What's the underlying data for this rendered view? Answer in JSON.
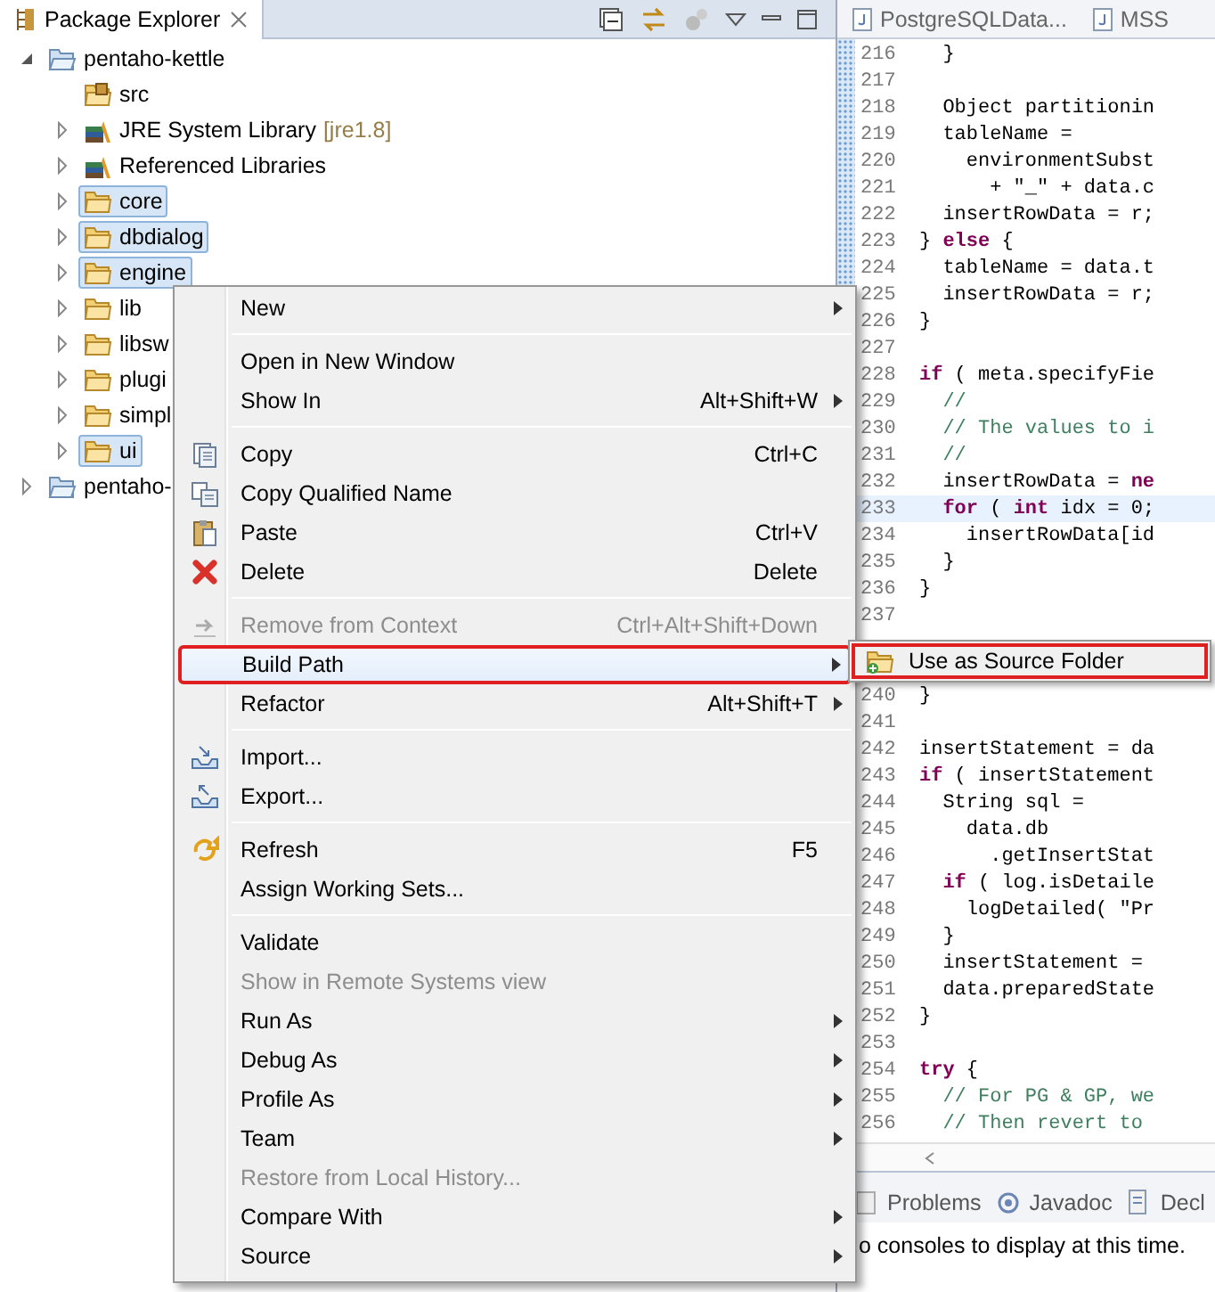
{
  "explorer": {
    "title": "Package Explorer",
    "tree": [
      {
        "label": "pentaho-kettle",
        "kind": "project",
        "expanded": true,
        "selected": false,
        "children": [
          {
            "label": "src",
            "kind": "source",
            "selected": false
          },
          {
            "label": "JRE System Library",
            "decoration": "[jre1.8]",
            "kind": "library",
            "expanded": false,
            "selected": false
          },
          {
            "label": "Referenced Libraries",
            "kind": "library",
            "expanded": false,
            "selected": false
          },
          {
            "label": "core",
            "kind": "folder",
            "expanded": false,
            "selected": true
          },
          {
            "label": "dbdialog",
            "kind": "folder",
            "expanded": false,
            "selected": true
          },
          {
            "label": "engine",
            "kind": "folder",
            "expanded": false,
            "selected": true
          },
          {
            "label": "lib",
            "kind": "folder",
            "expanded": false,
            "selected": false
          },
          {
            "label": "libsw",
            "kind": "folder",
            "expanded": false,
            "selected": false
          },
          {
            "label": "plugi",
            "kind": "folder",
            "expanded": false,
            "selected": false
          },
          {
            "label": "simpl",
            "kind": "folder",
            "expanded": false,
            "selected": false
          },
          {
            "label": "ui",
            "kind": "folder",
            "expanded": false,
            "selected": true
          }
        ]
      },
      {
        "label": "pentaho-",
        "kind": "project",
        "expanded": false,
        "selected": false
      }
    ]
  },
  "editor": {
    "tabs": [
      {
        "label": "PostgreSQLData...",
        "selected": false
      },
      {
        "label": "MSS",
        "selected": false
      }
    ],
    "lines": [
      {
        "number": "216",
        "text": "  }",
        "kind": "code",
        "current": false
      },
      {
        "number": "217",
        "current": false
      },
      {
        "number": "218",
        "text": "  Object partitionin",
        "kind": "code",
        "current": false
      },
      {
        "number": "219",
        "text": "  tableName =",
        "kind": "code",
        "current": false
      },
      {
        "number": "220",
        "text": "    environmentSubst",
        "kind": "code",
        "current": false
      },
      {
        "number": "221",
        "text": "      + \"_\" + data.c",
        "kind": "code",
        "current": false
      },
      {
        "number": "222",
        "text": "  insertRowData = r;",
        "kind": "code",
        "current": false
      },
      {
        "number": "223",
        "text": "} **else** {",
        "kind": "code",
        "current": false
      },
      {
        "number": "224",
        "text": "  tableName = data.t",
        "kind": "code",
        "current": false
      },
      {
        "number": "225",
        "text": "  insertRowData = r;",
        "kind": "code",
        "current": false
      },
      {
        "number": "226",
        "text": "}",
        "kind": "code",
        "current": false
      },
      {
        "number": "227",
        "current": false
      },
      {
        "number": "228",
        "text": "**if** ( meta.specifyFie",
        "kind": "code",
        "current": false
      },
      {
        "number": "229",
        "text": "  //",
        "kind": "comment",
        "current": false
      },
      {
        "number": "230",
        "text": "  // The values to i",
        "kind": "comment",
        "current": false
      },
      {
        "number": "231",
        "text": "  //",
        "kind": "comment",
        "current": false
      },
      {
        "number": "232",
        "text": "  insertRowData = **ne**",
        "kind": "code",
        "current": false
      },
      {
        "number": "233",
        "text": "  **for** ( **int** idx = 0;",
        "kind": "code",
        "current": true
      },
      {
        "number": "234",
        "text": "    insertRowData[id",
        "kind": "code",
        "current": false
      },
      {
        "number": "235",
        "text": "  }",
        "kind": "code",
        "current": false
      },
      {
        "number": "236",
        "text": "}",
        "kind": "code",
        "current": false
      },
      {
        "number": "237",
        "current": false
      },
      {
        "number": "240",
        "text": "}",
        "kind": "code",
        "current": false
      },
      {
        "number": "241",
        "current": false
      },
      {
        "number": "242",
        "text": "insertStatement = da",
        "kind": "code",
        "current": false
      },
      {
        "number": "243",
        "text": "**if** ( insertStatement",
        "kind": "code",
        "current": false
      },
      {
        "number": "244",
        "text": "  String sql =",
        "kind": "code",
        "current": false
      },
      {
        "number": "245",
        "text": "    data.db",
        "kind": "code",
        "current": false
      },
      {
        "number": "246",
        "text": "      .getInsertStat",
        "kind": "code",
        "current": false
      },
      {
        "number": "247",
        "text": "  **if** ( log.isDetaile",
        "kind": "code",
        "current": false
      },
      {
        "number": "248",
        "text": "    logDetailed( \"Pr",
        "kind": "code",
        "current": false
      },
      {
        "number": "249",
        "text": "  }",
        "kind": "code",
        "current": false
      },
      {
        "number": "250",
        "text": "  insertStatement =",
        "kind": "code",
        "current": false
      },
      {
        "number": "251",
        "text": "  data.preparedState",
        "kind": "code",
        "current": false
      },
      {
        "number": "252",
        "text": "}",
        "kind": "code",
        "current": false
      },
      {
        "number": "253",
        "current": false
      },
      {
        "number": "254",
        "text": "**try** {",
        "kind": "code",
        "current": false
      },
      {
        "number": "255",
        "text": "  // For PG & GP, we",
        "kind": "comment",
        "current": false
      },
      {
        "number": "256",
        "text": "  // Then revert to",
        "kind": "comment",
        "current": false
      }
    ]
  },
  "console": {
    "tabs": [
      {
        "label": "Problems",
        "kind": "problems"
      },
      {
        "label": "Javadoc",
        "kind": "javadoc"
      },
      {
        "label": "Decl",
        "kind": "declaration"
      }
    ],
    "message": "o consoles to display at this time."
  },
  "context_menu": {
    "items": [
      {
        "kind": "item",
        "label": "New",
        "submenu": true,
        "disabled": false,
        "selected": false,
        "outlined": false
      },
      {
        "kind": "separator"
      },
      {
        "kind": "item",
        "label": "Open in New Window",
        "submenu": false,
        "disabled": false,
        "selected": false,
        "outlined": false
      },
      {
        "kind": "item",
        "label": "Show In",
        "shortcut": "Alt+Shift+W",
        "submenu": true,
        "disabled": false,
        "selected": false,
        "outlined": false
      },
      {
        "kind": "separator"
      },
      {
        "kind": "copy",
        "label": "Copy",
        "shortcut": "Ctrl+C",
        "submenu": false,
        "disabled": false,
        "selected": false,
        "outlined": false
      },
      {
        "kind": "copy-qualified",
        "label": "Copy Qualified Name",
        "submenu": false,
        "disabled": false,
        "selected": false,
        "outlined": false
      },
      {
        "kind": "paste",
        "label": "Paste",
        "shortcut": "Ctrl+V",
        "submenu": false,
        "disabled": false,
        "selected": false,
        "outlined": false
      },
      {
        "kind": "delete",
        "label": "Delete",
        "shortcut": "Delete",
        "submenu": false,
        "disabled": false,
        "selected": false,
        "outlined": false
      },
      {
        "kind": "separator"
      },
      {
        "kind": "remove",
        "label": "Remove from Context",
        "shortcut": "Ctrl+Alt+Shift+Down",
        "submenu": false,
        "disabled": true,
        "selected": false,
        "outlined": false
      },
      {
        "kind": "item",
        "label": "Build Path",
        "submenu": true,
        "disabled": false,
        "selected": true,
        "outlined": true
      },
      {
        "kind": "item",
        "label": "Refactor",
        "shortcut": "Alt+Shift+T",
        "submenu": true,
        "disabled": false,
        "selected": false,
        "outlined": false
      },
      {
        "kind": "separator"
      },
      {
        "kind": "import",
        "label": "Import...",
        "submenu": false,
        "disabled": false,
        "selected": false,
        "outlined": false
      },
      {
        "kind": "export",
        "label": "Export...",
        "submenu": false,
        "disabled": false,
        "selected": false,
        "outlined": false
      },
      {
        "kind": "separator"
      },
      {
        "kind": "refresh",
        "label": "Refresh",
        "shortcut": "F5",
        "submenu": false,
        "disabled": false,
        "selected": false,
        "outlined": false
      },
      {
        "kind": "item",
        "label": "Assign Working Sets...",
        "submenu": false,
        "disabled": false,
        "selected": false,
        "outlined": false
      },
      {
        "kind": "separator"
      },
      {
        "kind": "item",
        "label": "Validate",
        "submenu": false,
        "disabled": false,
        "selected": false,
        "outlined": false
      },
      {
        "kind": "item",
        "label": "Show in Remote Systems view",
        "submenu": false,
        "disabled": true,
        "selected": false,
        "outlined": false
      },
      {
        "kind": "item",
        "label": "Run As",
        "submenu": true,
        "disabled": false,
        "selected": false,
        "outlined": false
      },
      {
        "kind": "item",
        "label": "Debug As",
        "submenu": true,
        "disabled": false,
        "selected": false,
        "outlined": false
      },
      {
        "kind": "item",
        "label": "Profile As",
        "submenu": true,
        "disabled": false,
        "selected": false,
        "outlined": false
      },
      {
        "kind": "item",
        "label": "Team",
        "submenu": true,
        "disabled": false,
        "selected": false,
        "outlined": false
      },
      {
        "kind": "item",
        "label": "Restore from Local History...",
        "submenu": false,
        "disabled": true,
        "selected": false,
        "outlined": false
      },
      {
        "kind": "item",
        "label": "Compare With",
        "submenu": true,
        "disabled": false,
        "selected": false,
        "outlined": false
      },
      {
        "kind": "item",
        "label": "Source",
        "submenu": true,
        "disabled": false,
        "selected": false,
        "outlined": false
      }
    ]
  },
  "submenu": {
    "items": [
      {
        "label": "Use as Source Folder",
        "selected": false,
        "outlined": true
      }
    ]
  }
}
